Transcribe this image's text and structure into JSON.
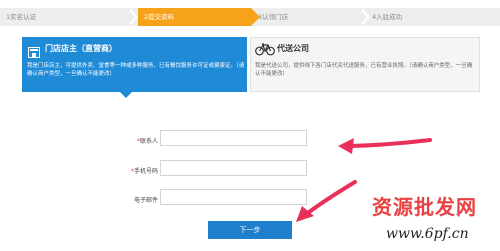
{
  "steps": [
    {
      "label": "1实名认证"
    },
    {
      "label": "2提交资料"
    },
    {
      "label": "3认领门店"
    },
    {
      "label": "4入驻成功"
    }
  ],
  "cards": {
    "store": {
      "title": "门店店主（直营商）",
      "desc": "我是门店店主，可提供外卖、堂食等一种或多种服务，已有餐饮服务许可证或健康证。（请确认商户类型，一旦确认不能更改）"
    },
    "delivery": {
      "title": "代送公司",
      "desc": "我是代送公司，提供线下各门店代买代送服务，已有营业执照。（请确认商户类型，一旦确认不能更改）"
    }
  },
  "form": {
    "contact_label": "联系人",
    "phone_label": "手机号码",
    "email_label": "电子邮件",
    "required_mark": "*",
    "next_button": "下一步"
  },
  "watermark": {
    "text": "资源批发网",
    "dots": "......",
    "url": "www.6pf.cn"
  },
  "colors": {
    "accent_blue": "#1f8ad6",
    "step_active": "#f6a21b",
    "annotation_arrow": "#e8305a"
  }
}
